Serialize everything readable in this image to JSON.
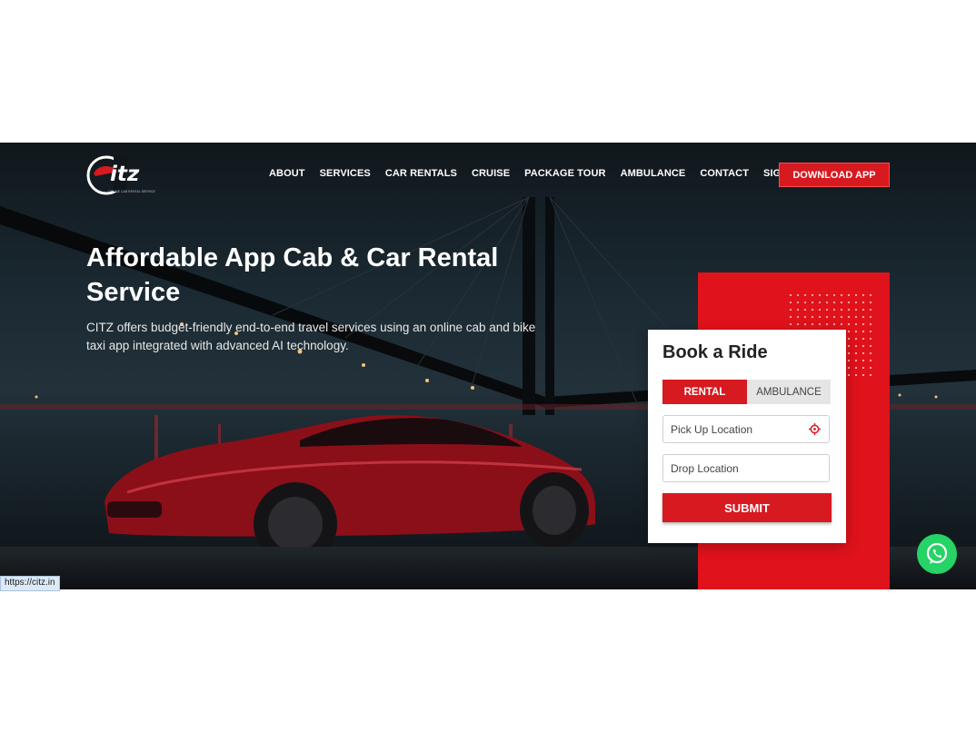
{
  "brand": {
    "logo_text": "itz",
    "logo_tagline": "ONLINE CAB RENTAL SERVICE",
    "accent": "#d71920"
  },
  "nav": {
    "items": [
      "ABOUT",
      "SERVICES",
      "CAR RENTALS",
      "CRUISE",
      "PACKAGE TOUR",
      "AMBULANCE",
      "CONTACT",
      "SIGNIN"
    ],
    "download_label": "DOWNLOAD APP"
  },
  "hero": {
    "headline": "Affordable App Cab & Car Rental Service",
    "subtext": "CITZ offers budget-friendly end-to-end travel services using an online cab and bike taxi app integrated with advanced AI technology."
  },
  "booking": {
    "title": "Book a Ride",
    "tabs": [
      "RENTAL",
      "AMBULANCE"
    ],
    "active_tab": "RENTAL",
    "pickup_placeholder": "Pick Up Location",
    "drop_placeholder": "Drop Location",
    "submit_label": "SUBMIT",
    "pin_icon": "location-target-icon"
  },
  "whatsapp_icon": "whatsapp-icon",
  "status_url": "https://citz.in"
}
